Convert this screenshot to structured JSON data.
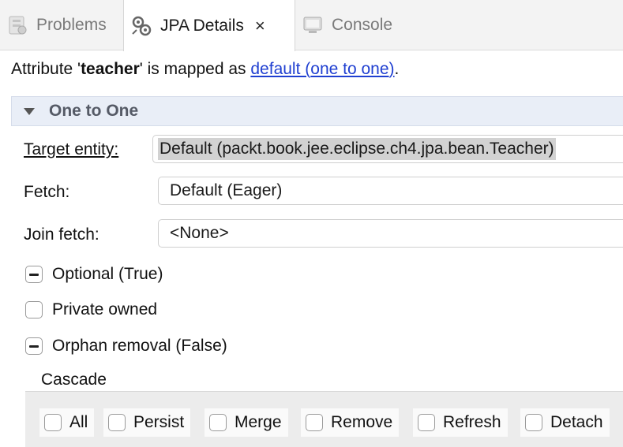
{
  "tabs": [
    {
      "label": "Problems",
      "icon": "problems-icon",
      "active": false
    },
    {
      "label": "JPA Details",
      "icon": "jpa-details-icon",
      "active": true,
      "close": "×"
    },
    {
      "label": "Console",
      "icon": "console-icon",
      "active": false
    }
  ],
  "attribute": {
    "prefix": "Attribute '",
    "name": "teacher",
    "middle": "' is mapped as ",
    "mapping_link_1": "default (",
    "mapping_link_2": "one to one",
    "mapping_link_3": ")",
    "suffix": "."
  },
  "section": {
    "title": "One to One"
  },
  "target_entity": {
    "label": "Target entity:",
    "value": "Default (packt.book.jee.eclipse.ch4.jpa.bean.Teacher)"
  },
  "fetch": {
    "label": "Fetch:",
    "value": "Default (Eager)"
  },
  "join_fetch": {
    "label": "Join fetch:",
    "value": "<None>"
  },
  "checkboxes": [
    {
      "label": "Optional (True)",
      "state": "indeterminate"
    },
    {
      "label": "Private owned",
      "state": "unchecked"
    },
    {
      "label": "Orphan removal (False)",
      "state": "indeterminate"
    }
  ],
  "cascade": {
    "label": "Cascade",
    "options": [
      "All",
      "Persist",
      "Merge",
      "Remove",
      "Refresh",
      "Detach"
    ]
  },
  "colors": {
    "link": "#1f3fd1",
    "section_bg": "#e9eef7"
  }
}
